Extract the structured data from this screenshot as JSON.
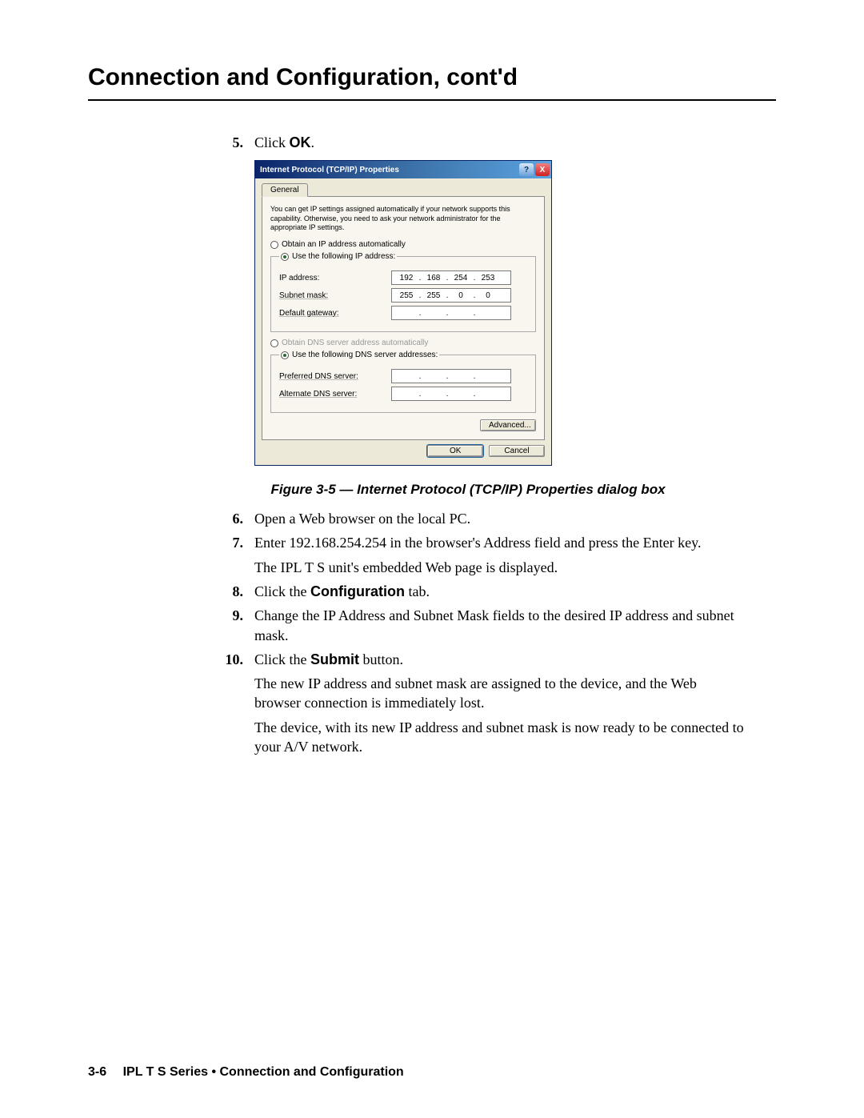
{
  "pageTitle": "Connection and Configuration, cont'd",
  "steps": {
    "s5": {
      "num": "5.",
      "pre": "Click ",
      "bold": "OK",
      "post": "."
    },
    "s6": {
      "num": "6.",
      "text": "Open a Web browser on the local PC."
    },
    "s7": {
      "num": "7.",
      "text": "Enter 192.168.254.254 in the browser's Address field and press the Enter key.",
      "sub": "The IPL T S unit's embedded Web page is displayed."
    },
    "s8": {
      "num": "8.",
      "pre": "Click the ",
      "bold": "Configuration",
      "post": " tab."
    },
    "s9": {
      "num": "9.",
      "text": "Change the IP Address and Subnet Mask fields to the desired IP address and subnet mask."
    },
    "s10": {
      "num": "10.",
      "pre": "Click the ",
      "bold": "Submit",
      "post": " button.",
      "sub1": "The new IP address and subnet mask are assigned to the device, and the Web browser connection is immediately lost.",
      "sub2": "The device, with its new IP address and subnet mask is now ready to be connected to your A/V network."
    }
  },
  "dialog": {
    "title": "Internet Protocol (TCP/IP) Properties",
    "tab": "General",
    "info": "You can get IP settings assigned automatically if your network supports this capability. Otherwise, you need to ask your network administrator for the appropriate IP settings.",
    "radioAutoIp": "Obtain an IP address automatically",
    "radioUseIp": "Use the following IP address:",
    "ipLabel": "IP address:",
    "subnetLabel": "Subnet mask:",
    "gatewayLabel": "Default gateway:",
    "ip": [
      "192",
      "168",
      "254",
      "253"
    ],
    "subnet": [
      "255",
      "255",
      "0",
      "0"
    ],
    "gateway": [
      "",
      "",
      "",
      ""
    ],
    "radioAutoDns": "Obtain DNS server address automatically",
    "radioUseDns": "Use the following DNS server addresses:",
    "prefDnsLabel": "Preferred DNS server:",
    "altDnsLabel": "Alternate DNS server:",
    "prefDns": [
      "",
      "",
      "",
      ""
    ],
    "altDns": [
      "",
      "",
      "",
      ""
    ],
    "advanced": "Advanced...",
    "ok": "OK",
    "cancel": "Cancel",
    "help": "?",
    "close": "X"
  },
  "figureCaption": "Figure 3-5 — Internet Protocol (TCP/IP) Properties dialog box",
  "footer": {
    "pageNum": "3-6",
    "text": "IPL T S Series • Connection and Configuration"
  }
}
